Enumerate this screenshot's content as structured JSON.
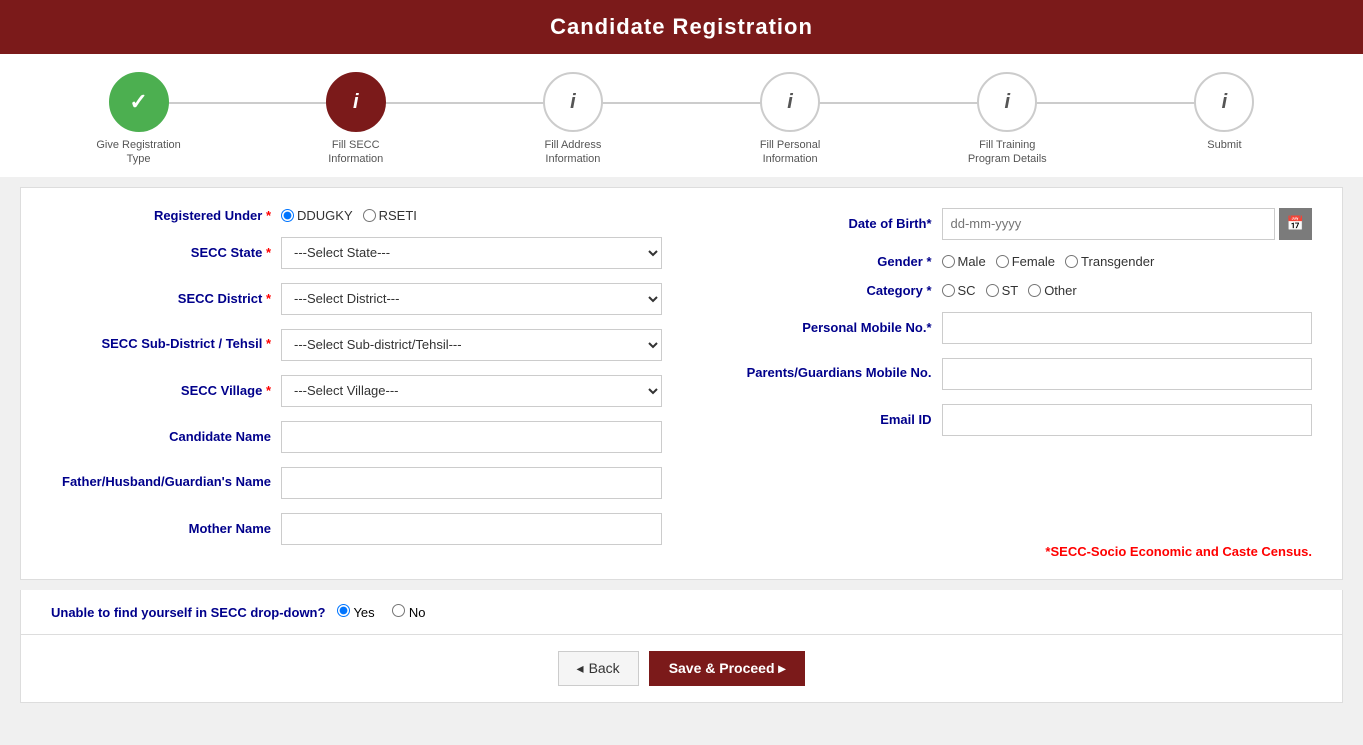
{
  "header": {
    "title": "Candidate Registration"
  },
  "stepper": {
    "steps": [
      {
        "label": "Give Registration Type",
        "state": "completed",
        "icon": "✓"
      },
      {
        "label": "Fill SECC Information",
        "state": "active",
        "icon": "i"
      },
      {
        "label": "Fill Address Information",
        "state": "inactive",
        "icon": "i"
      },
      {
        "label": "Fill Personal Information",
        "state": "inactive",
        "icon": "i"
      },
      {
        "label": "Fill Training Program Details",
        "state": "inactive",
        "icon": "i"
      },
      {
        "label": "Submit",
        "state": "inactive",
        "icon": "i"
      }
    ]
  },
  "form": {
    "registered_under_label": "Registered Under",
    "registered_under_options": [
      "DDUGKY",
      "RSETI"
    ],
    "secc_state_label": "SECC State",
    "secc_state_placeholder": "---Select State---",
    "secc_district_label": "SECC District",
    "secc_district_placeholder": "---Select District---",
    "secc_subdistrict_label": "SECC Sub-District / Tehsil",
    "secc_subdistrict_placeholder": "---Select Sub-district/Tehsil---",
    "secc_village_label": "SECC Village",
    "secc_village_placeholder": "---Select Village---",
    "candidate_name_label": "Candidate Name",
    "father_name_label": "Father/Husband/Guardian's Name",
    "mother_name_label": "Mother Name",
    "dob_label": "Date of Birth",
    "dob_placeholder": "dd-mm-yyyy",
    "gender_label": "Gender",
    "gender_options": [
      "Male",
      "Female",
      "Transgender"
    ],
    "category_label": "Category",
    "category_options": [
      "SC",
      "ST",
      "Other"
    ],
    "personal_mobile_label": "Personal Mobile No.",
    "guardian_mobile_label": "Parents/Guardians Mobile No.",
    "email_label": "Email ID",
    "secc_note": "*SECC-Socio Economic and Caste Census."
  },
  "unable_section": {
    "question": "Unable to find yourself in SECC drop-down?",
    "options": [
      "Yes",
      "No"
    ],
    "selected": "Yes"
  },
  "buttons": {
    "back": "◂ Back",
    "save_proceed": "Save & Proceed ▸"
  }
}
